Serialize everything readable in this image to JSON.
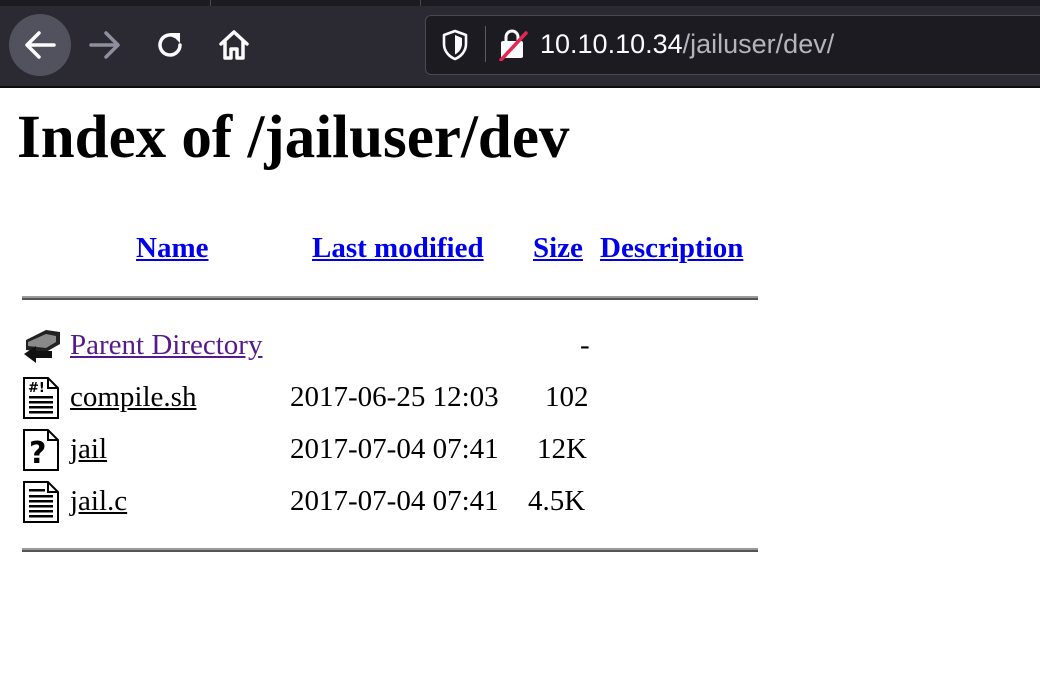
{
  "browser": {
    "url_host": "10.10.10.34",
    "url_path": "/jailuser/dev/",
    "icons": [
      "back-arrow-icon",
      "forward-arrow-icon",
      "reload-icon",
      "home-icon",
      "shield-icon",
      "insecure-lock-icon"
    ]
  },
  "page": {
    "title": "Index of /jailuser/dev",
    "columns": {
      "name": "Name",
      "last_modified": "Last modified",
      "size": "Size",
      "description": "Description"
    },
    "rows": [
      {
        "name": "Parent Directory",
        "modified": "",
        "size": "-",
        "icon": "back-folder-icon"
      },
      {
        "name": "compile.sh",
        "modified": "2017-06-25 12:03",
        "size": "102",
        "icon": "text-file-icon"
      },
      {
        "name": "jail",
        "modified": "2017-07-04 07:41",
        "size": "12K",
        "icon": "unknown-file-icon"
      },
      {
        "name": "jail.c",
        "modified": "2017-07-04 07:41",
        "size": "4.5K",
        "icon": "text-file-icon"
      }
    ]
  },
  "colors": {
    "link": "#0000ee",
    "visited_link": "#551a8b",
    "toolbar_bg": "#2b2a33",
    "urlbar_bg": "#1c1b22"
  }
}
